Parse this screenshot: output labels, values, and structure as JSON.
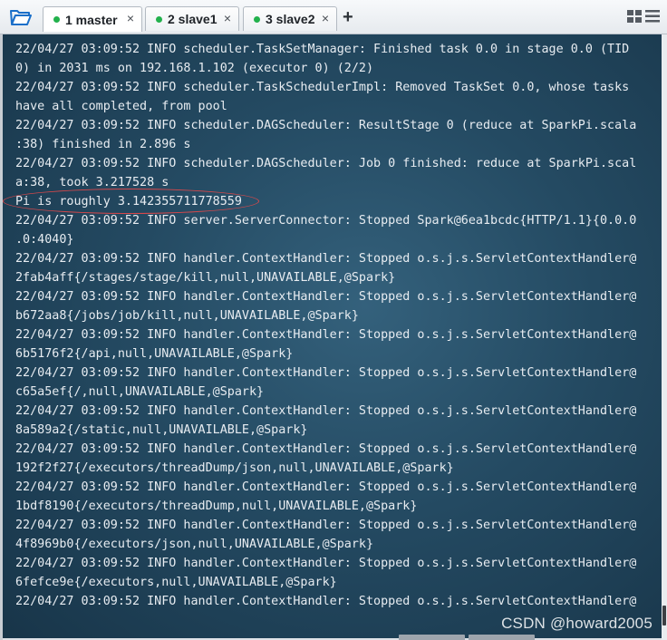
{
  "tabs": [
    {
      "label": "1 master",
      "active": true,
      "status_color": "#22b14c"
    },
    {
      "label": "2 slave1",
      "active": false,
      "status_color": "#22b14c"
    },
    {
      "label": "3 slave2",
      "active": false,
      "status_color": "#22b14c"
    }
  ],
  "tab_close_glyph": "×",
  "add_tab_glyph": "+",
  "terminal": {
    "lines": [
      "22/04/27 03:09:52 INFO scheduler.TaskSetManager: Finished task 0.0 in stage 0.0 (TID",
      "0) in 2031 ms on 192.168.1.102 (executor 0) (2/2)",
      "22/04/27 03:09:52 INFO scheduler.TaskSchedulerImpl: Removed TaskSet 0.0, whose tasks",
      "have all completed, from pool",
      "22/04/27 03:09:52 INFO scheduler.DAGScheduler: ResultStage 0 (reduce at SparkPi.scala",
      ":38) finished in 2.896 s",
      "22/04/27 03:09:52 INFO scheduler.DAGScheduler: Job 0 finished: reduce at SparkPi.scal",
      "a:38, took 3.217528 s",
      "Pi is roughly 3.142355711778559",
      "22/04/27 03:09:52 INFO server.ServerConnector: Stopped Spark@6ea1bcdc{HTTP/1.1}{0.0.0",
      ".0:4040}",
      "22/04/27 03:09:52 INFO handler.ContextHandler: Stopped o.s.j.s.ServletContextHandler@",
      "2fab4aff{/stages/stage/kill,null,UNAVAILABLE,@Spark}",
      "22/04/27 03:09:52 INFO handler.ContextHandler: Stopped o.s.j.s.ServletContextHandler@",
      "b672aa8{/jobs/job/kill,null,UNAVAILABLE,@Spark}",
      "22/04/27 03:09:52 INFO handler.ContextHandler: Stopped o.s.j.s.ServletContextHandler@",
      "6b5176f2{/api,null,UNAVAILABLE,@Spark}",
      "22/04/27 03:09:52 INFO handler.ContextHandler: Stopped o.s.j.s.ServletContextHandler@",
      "c65a5ef{/,null,UNAVAILABLE,@Spark}",
      "22/04/27 03:09:52 INFO handler.ContextHandler: Stopped o.s.j.s.ServletContextHandler@",
      "8a589a2{/static,null,UNAVAILABLE,@Spark}",
      "22/04/27 03:09:52 INFO handler.ContextHandler: Stopped o.s.j.s.ServletContextHandler@",
      "192f2f27{/executors/threadDump/json,null,UNAVAILABLE,@Spark}",
      "22/04/27 03:09:52 INFO handler.ContextHandler: Stopped o.s.j.s.ServletContextHandler@",
      "1bdf8190{/executors/threadDump,null,UNAVAILABLE,@Spark}",
      "22/04/27 03:09:52 INFO handler.ContextHandler: Stopped o.s.j.s.ServletContextHandler@",
      "4f8969b0{/executors/json,null,UNAVAILABLE,@Spark}",
      "22/04/27 03:09:52 INFO handler.ContextHandler: Stopped o.s.j.s.ServletContextHandler@",
      "6fefce9e{/executors,null,UNAVAILABLE,@Spark}",
      "22/04/27 03:09:52 INFO handler.ContextHandler: Stopped o.s.j.s.ServletContextHandler@"
    ],
    "highlight_color": "#d8484b"
  },
  "watermark": "CSDN @howard2005",
  "icons": {
    "open_folder": "folder-open-icon",
    "grid_view": "grid-view-icon",
    "list_view": "list-menu-icon"
  }
}
